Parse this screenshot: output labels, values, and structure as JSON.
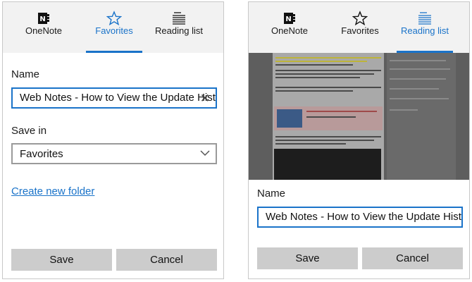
{
  "left_panel": {
    "tabs": [
      {
        "label": "OneNote",
        "icon": "onenote-icon",
        "active": false
      },
      {
        "label": "Favorites",
        "icon": "star-icon",
        "active": true
      },
      {
        "label": "Reading list",
        "icon": "reading-list-icon",
        "active": false
      }
    ],
    "name_label": "Name",
    "name_value": "Web Notes - How to View the Update History",
    "save_in_label": "Save in",
    "save_in_value": "Favorites",
    "create_folder_link": "Create new folder",
    "save_button": "Save",
    "cancel_button": "Cancel"
  },
  "right_panel": {
    "tabs": [
      {
        "label": "OneNote",
        "icon": "onenote-icon",
        "active": false
      },
      {
        "label": "Favorites",
        "icon": "star-icon",
        "active": false
      },
      {
        "label": "Reading list",
        "icon": "reading-list-icon",
        "active": true
      }
    ],
    "name_label": "Name",
    "name_value": "Web Notes - How to View the Update History",
    "save_button": "Save",
    "cancel_button": "Cancel"
  },
  "colors": {
    "accent": "#1a73c9",
    "tabbar_bg": "#f2f2f2",
    "button_bg": "#cccccc"
  }
}
